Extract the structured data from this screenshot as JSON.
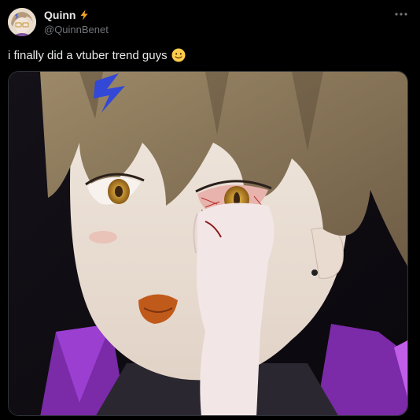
{
  "post": {
    "display_name": "Quinn",
    "handle": "@QuinnBenet",
    "text": "i finally did a vtuber trend guys",
    "emoji": "slightly-smiling-face",
    "badge_icon": "lightning-bolt-icon",
    "more_icon": "more-options-icon",
    "media_alt": "Illustration of an anime character with an injured eye"
  },
  "colors": {
    "background": "#000000",
    "text_primary": "#e7e9ea",
    "text_secondary": "#71767b",
    "bolt": "#f5a623",
    "border": "#2f3336"
  }
}
